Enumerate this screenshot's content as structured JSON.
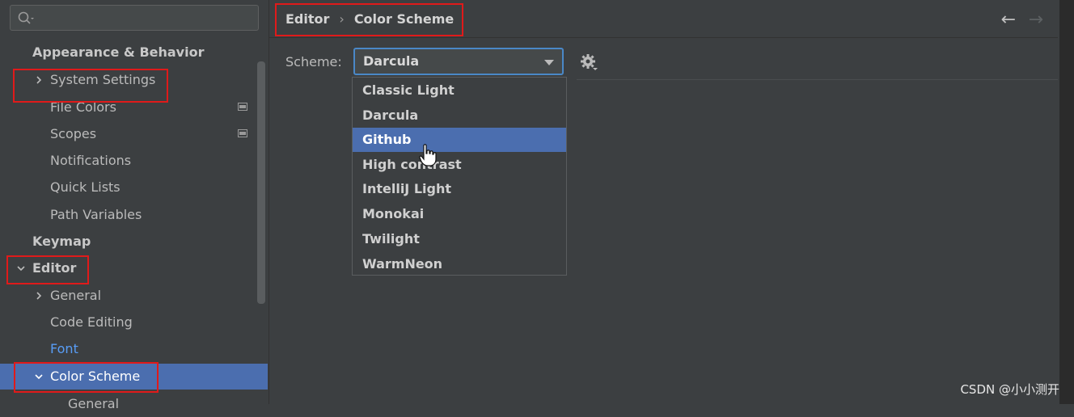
{
  "sidebar": {
    "search": {
      "placeholder": ""
    },
    "items": [
      {
        "label": "Appearance & Behavior"
      },
      {
        "label": "System Settings"
      },
      {
        "label": "File Colors"
      },
      {
        "label": "Scopes"
      },
      {
        "label": "Notifications"
      },
      {
        "label": "Quick Lists"
      },
      {
        "label": "Path Variables"
      },
      {
        "label": "Keymap"
      },
      {
        "label": "Editor"
      },
      {
        "label": "General"
      },
      {
        "label": "Code Editing"
      },
      {
        "label": "Font"
      },
      {
        "label": "Color Scheme"
      },
      {
        "label": "General"
      }
    ]
  },
  "header": {
    "breadcrumb": [
      "Editor",
      "Color Scheme"
    ],
    "separator": "›",
    "back_icon": "arrow-left-icon",
    "forward_icon": "arrow-right-icon"
  },
  "scheme": {
    "label": "Scheme:",
    "value": "Darcula",
    "options": [
      "Classic Light",
      "Darcula",
      "Github",
      "High contrast",
      "IntelliJ Light",
      "Monokai",
      "Twilight",
      "WarmNeon"
    ],
    "highlighted": "Github"
  },
  "watermark": "CSDN @小小测开",
  "colors": {
    "accent": "#4b6eaf",
    "highlight_box": "#e01a1a",
    "link": "#589df6"
  }
}
